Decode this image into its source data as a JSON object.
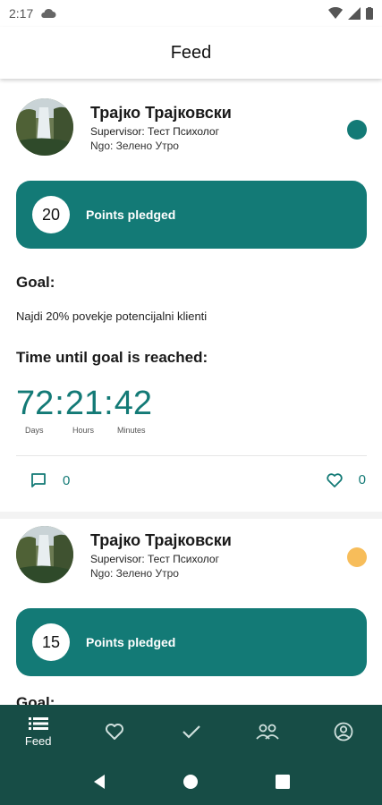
{
  "status_bar": {
    "time": "2:17"
  },
  "app_bar": {
    "title": "Feed"
  },
  "posts": [
    {
      "name": "Трајко Трајковски",
      "supervisor": "Supervisor: Тест Психолог",
      "ngo": "Ngo: Зелено Утро",
      "status_color": "#137a76",
      "points": "20",
      "points_label": "Points pledged",
      "goal_title": "Goal:",
      "goal_text": "Najdi 20% povekje potencijalni klienti",
      "time_title": "Time until goal is reached:",
      "days": "72",
      "hours": "21",
      "minutes": "42",
      "days_label": "Days",
      "hours_label": "Hours",
      "minutes_label": "Minutes",
      "comments": "0",
      "likes": "0"
    },
    {
      "name": "Трајко Трајковски",
      "supervisor": "Supervisor: Тест Психолог",
      "ngo": "Ngo: Зелено Утро",
      "status_color": "#f7bd5a",
      "points": "15",
      "points_label": "Points pledged",
      "goal_title": "Goal:"
    }
  ],
  "bottom_nav": {
    "items": [
      {
        "label": "Feed",
        "icon": "list-icon",
        "active": true
      },
      {
        "label": "",
        "icon": "heart-icon"
      },
      {
        "label": "",
        "icon": "check-icon"
      },
      {
        "label": "",
        "icon": "group-icon"
      },
      {
        "label": "",
        "icon": "account-icon"
      }
    ]
  },
  "colors": {
    "accent": "#137a76",
    "nav_bg": "#174d46",
    "pending": "#f7bd5a"
  }
}
